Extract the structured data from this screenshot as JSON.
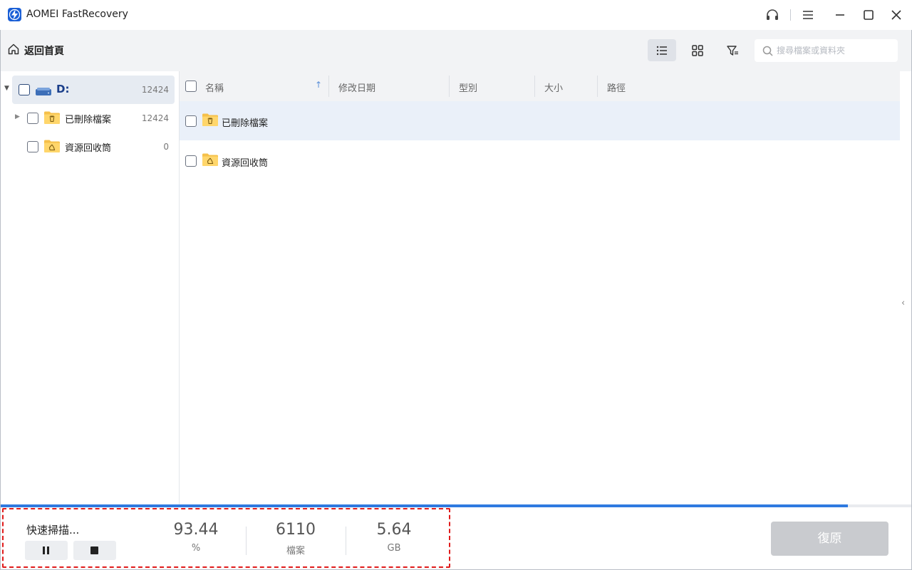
{
  "app": {
    "title": "AOMEI FastRecovery"
  },
  "toolbar": {
    "home_label": "返回首頁",
    "search_placeholder": "搜尋檔案或資料夾",
    "active_view": "list"
  },
  "tree": {
    "drive": {
      "label": "D:",
      "count": "12424"
    },
    "items": [
      {
        "label": "已刪除檔案",
        "count": "12424",
        "icon": "trash-folder-icon"
      },
      {
        "label": "資源回收筒",
        "count": "0",
        "icon": "recycle-folder-icon"
      }
    ]
  },
  "list": {
    "columns": [
      "名稱",
      "修改日期",
      "型別",
      "大小",
      "路徑"
    ],
    "rows": [
      {
        "name": "已刪除檔案",
        "icon": "trash-folder-icon"
      },
      {
        "name": "資源回收筒",
        "icon": "recycle-folder-icon"
      }
    ]
  },
  "scan": {
    "status": "快速掃描...",
    "progress_percent": 93,
    "percent_value": "93.44",
    "percent_unit": "%",
    "files_value": "6110",
    "files_unit": "檔案",
    "size_value": "5.64",
    "size_unit": "GB"
  },
  "recover_label": "復原",
  "colors": {
    "accent": "#2f7ae0",
    "highlight_dash": "#e01b1b",
    "folder": "#f5c04a"
  }
}
